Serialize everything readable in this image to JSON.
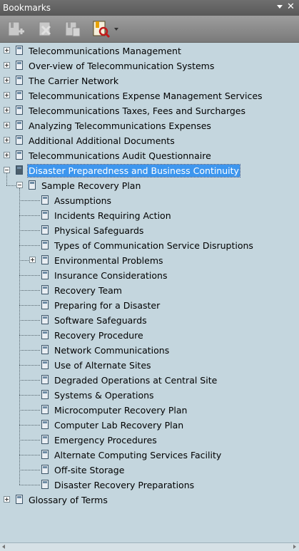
{
  "panel": {
    "title": "Bookmarks",
    "close_glyph": "✕"
  },
  "toolbar": {
    "buttons": [
      {
        "name": "new-bookmark-icon"
      },
      {
        "name": "delete-bookmark-icon"
      },
      {
        "name": "bookmark-page-icon"
      },
      {
        "name": "bookmark-options-icon"
      }
    ]
  },
  "bookmarks": [
    {
      "label": "Telecommunications Management",
      "level": 0,
      "expander": "plus"
    },
    {
      "label": "Over-view of Telecommunication Systems",
      "level": 0,
      "expander": "plus"
    },
    {
      "label": "The Carrier Network",
      "level": 0,
      "expander": "plus"
    },
    {
      "label": "Telecommunications Expense Management Services",
      "level": 0,
      "expander": "plus"
    },
    {
      "label": "Telecommunications Taxes, Fees and Surcharges",
      "level": 0,
      "expander": "plus"
    },
    {
      "label": "Analyzing Telecommunications Expenses",
      "level": 0,
      "expander": "plus"
    },
    {
      "label": "Additional Additional Documents",
      "level": 0,
      "expander": "plus"
    },
    {
      "label": "Telecommunications Audit Questionnaire",
      "level": 0,
      "expander": "plus"
    },
    {
      "label": "Disaster Preparedness and Business Continuity",
      "level": 0,
      "expander": "minus",
      "selected": true,
      "open": true
    },
    {
      "label": "Sample Recovery Plan",
      "level": 1,
      "expander": "minus"
    },
    {
      "label": "Assumptions",
      "level": 2
    },
    {
      "label": "Incidents Requiring Action",
      "level": 2
    },
    {
      "label": "Physical Safeguards",
      "level": 2
    },
    {
      "label": "Types of Communication Service Disruptions",
      "level": 2
    },
    {
      "label": "Environmental Problems",
      "level": 2,
      "expander": "plus"
    },
    {
      "label": "Insurance Considerations",
      "level": 2
    },
    {
      "label": "Recovery Team",
      "level": 2
    },
    {
      "label": "Preparing for a Disaster",
      "level": 2
    },
    {
      "label": "Software Safeguards",
      "level": 2
    },
    {
      "label": "Recovery Procedure",
      "level": 2
    },
    {
      "label": "Network Communications",
      "level": 2
    },
    {
      "label": "Use of Alternate Sites",
      "level": 2
    },
    {
      "label": "Degraded Operations at Central Site",
      "level": 2
    },
    {
      "label": "Systems & Operations",
      "level": 2
    },
    {
      "label": "Microcomputer Recovery Plan",
      "level": 2
    },
    {
      "label": "Computer Lab Recovery Plan",
      "level": 2
    },
    {
      "label": "Emergency Procedures",
      "level": 2
    },
    {
      "label": "Alternate Computing Services Facility",
      "level": 2
    },
    {
      "label": "Off-site Storage",
      "level": 2
    },
    {
      "label": "Disaster Recovery Preparations",
      "level": 2
    },
    {
      "label": "Glossary of Terms",
      "level": 0,
      "expander": "plus"
    }
  ]
}
